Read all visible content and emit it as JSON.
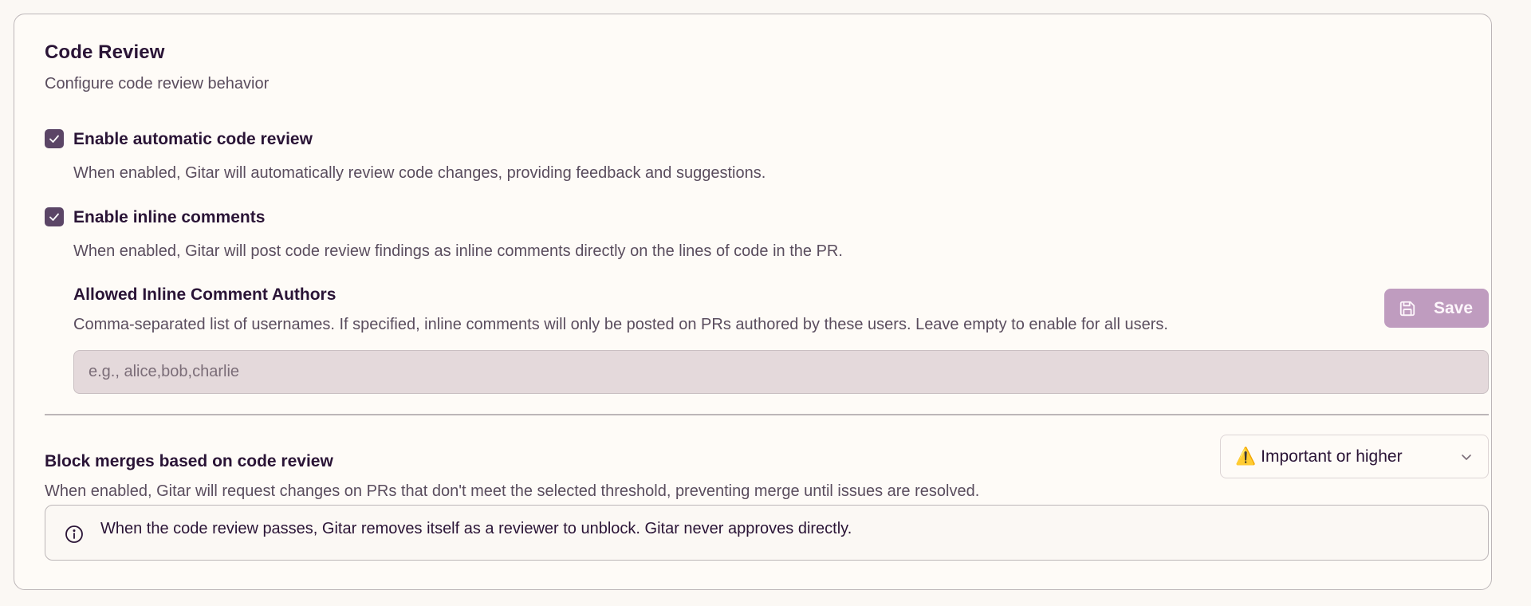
{
  "header": {
    "title": "Code Review",
    "subtitle": "Configure code review behavior"
  },
  "options": {
    "auto_review": {
      "label": "Enable automatic code review",
      "checked": true,
      "description": "When enabled, Gitar will automatically review code changes, providing feedback and suggestions."
    },
    "inline_comments": {
      "label": "Enable inline comments",
      "checked": true,
      "description": "When enabled, Gitar will post code review findings as inline comments directly on the lines of code in the PR."
    }
  },
  "authors": {
    "label": "Allowed Inline Comment Authors",
    "description": "Comma-separated list of usernames. If specified, inline comments will only be posted on PRs authored by these users. Leave empty to enable for all users.",
    "value": "",
    "placeholder": "e.g., alice,bob,charlie",
    "save_label": "Save",
    "save_icon": "floppy-disk-icon"
  },
  "block_merges": {
    "label": "Block merges based on code review",
    "description": "When enabled, Gitar will request changes on PRs that don't meet the selected threshold, preventing merge until issues are resolved.",
    "selected_emoji": "⚠️",
    "selected_value": "Important or higher"
  },
  "info": {
    "icon": "info-icon",
    "message": "When the code review passes, Gitar removes itself as a reviewer to unblock. Gitar never approves directly."
  },
  "colors": {
    "accent": "#5b4566",
    "save_button": "#bf9cbf",
    "input_bg": "#e4d9db",
    "card_bg": "#fefbf7"
  }
}
